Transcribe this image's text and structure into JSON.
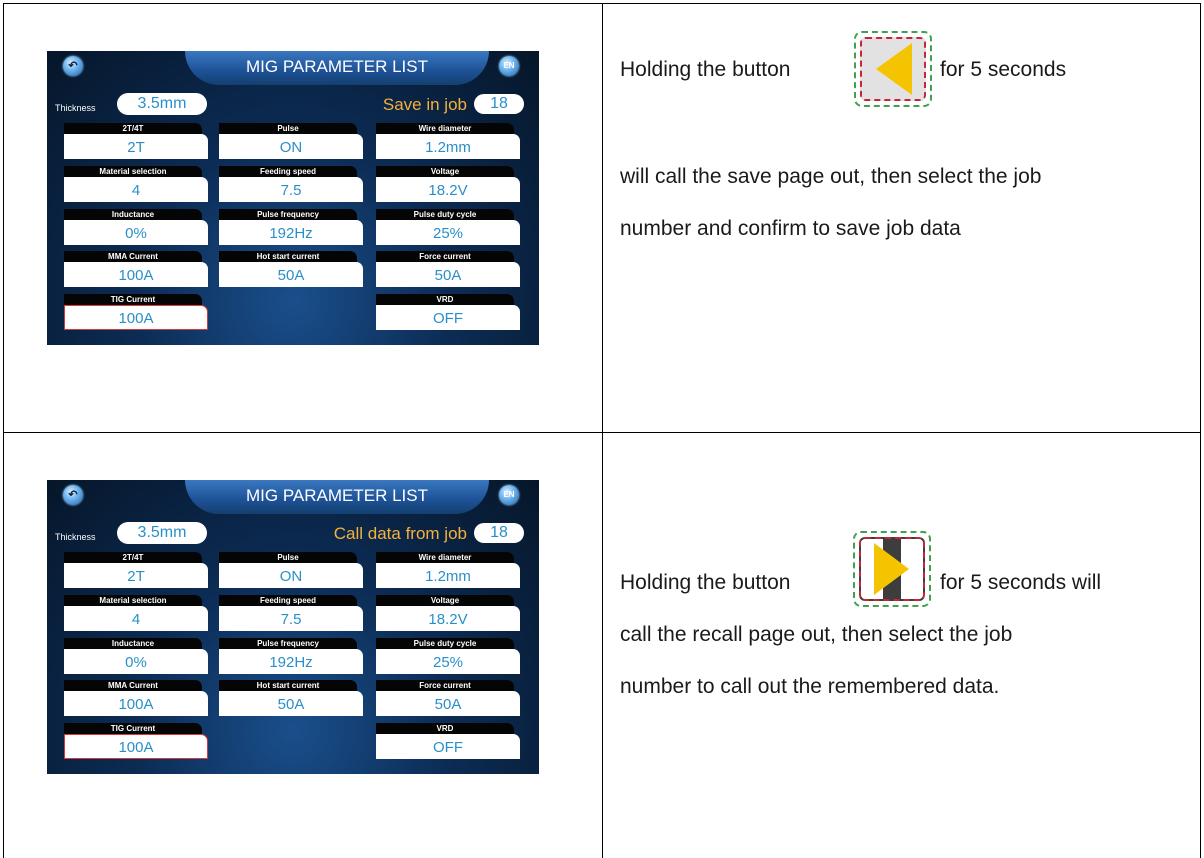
{
  "rows": [
    {
      "screen": {
        "title": "MIG PARAMETER LIST",
        "lang_icon": "EN",
        "back_icon": "back-arrow-icon",
        "thickness_label": "Thickness",
        "thickness_value": "3.5mm",
        "job_label": "Save in job",
        "job_value": "18",
        "params": [
          {
            "label": "2T/4T",
            "value": "2T"
          },
          {
            "label": "Pulse",
            "value": "ON"
          },
          {
            "label": "Wire diameter",
            "value": "1.2mm"
          },
          {
            "label": "Material selection",
            "value": "4"
          },
          {
            "label": "Feeding speed",
            "value": "7.5"
          },
          {
            "label": "Voltage",
            "value": "18.2V"
          },
          {
            "label": "Inductance",
            "value": "0%"
          },
          {
            "label": "Pulse frequency",
            "value": "192Hz"
          },
          {
            "label": "Pulse duty cycle",
            "value": "25%"
          },
          {
            "label": "MMA Current",
            "value": "100A"
          },
          {
            "label": "Hot start current",
            "value": "50A"
          },
          {
            "label": "Force current",
            "value": "50A"
          },
          {
            "label": "TIG Current",
            "value": "100A"
          },
          {
            "label": "VRD",
            "value": "OFF"
          }
        ]
      },
      "button_icon": "left-triangle-icon",
      "text_before": "Holding the button",
      "text_after": "for 5 seconds",
      "lines": [
        "will call the save page out, then select the job",
        "number and confirm to save job data"
      ]
    },
    {
      "screen": {
        "title": "MIG PARAMETER LIST",
        "lang_icon": "EN",
        "back_icon": "back-arrow-icon",
        "thickness_label": "Thickness",
        "thickness_value": "3.5mm",
        "job_label": "Call data from job",
        "job_value": "18",
        "params": [
          {
            "label": "2T/4T",
            "value": "2T"
          },
          {
            "label": "Pulse",
            "value": "ON"
          },
          {
            "label": "Wire diameter",
            "value": "1.2mm"
          },
          {
            "label": "Material selection",
            "value": "4"
          },
          {
            "label": "Feeding speed",
            "value": "7.5"
          },
          {
            "label": "Voltage",
            "value": "18.2V"
          },
          {
            "label": "Inductance",
            "value": "0%"
          },
          {
            "label": "Pulse frequency",
            "value": "192Hz"
          },
          {
            "label": "Pulse duty cycle",
            "value": "25%"
          },
          {
            "label": "MMA Current",
            "value": "100A"
          },
          {
            "label": "Hot start current",
            "value": "50A"
          },
          {
            "label": "Force current",
            "value": "50A"
          },
          {
            "label": "TIG Current",
            "value": "100A"
          },
          {
            "label": "VRD",
            "value": "OFF"
          }
        ]
      },
      "button_icon": "right-triangle-icon",
      "text_before": "Holding the button",
      "text_after": "for 5 seconds will",
      "lines": [
        "call the recall  page out, then select the job",
        "number to call out the remembered data."
      ]
    }
  ],
  "colors": {
    "screen_dark": "#061629",
    "title_blue": "#1d5196",
    "value_text": "#2a8fc9",
    "job_label": "#f3b13b",
    "button_triangle": "#f5c400",
    "outer_dash": "#3fa34d",
    "inner_dash": "#c5263a"
  }
}
